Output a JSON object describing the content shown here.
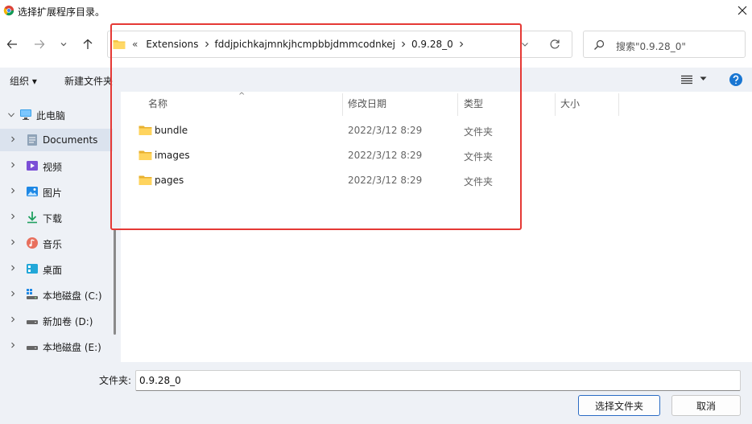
{
  "window": {
    "title": "选择扩展程序目录。"
  },
  "address": {
    "overflow": "«",
    "crumbs": [
      "Extensions",
      "fddjpichkajmnkjhcmpbbjdmmcodnkej",
      "0.9.28_0"
    ]
  },
  "search": {
    "placeholder": "搜索\"0.9.28_0\""
  },
  "commands": {
    "organize": "组织 ▾",
    "new_folder": "新建文件夹"
  },
  "sidebar": {
    "items": [
      {
        "label": "此电脑",
        "icon": "pc-icon"
      },
      {
        "label": "Documents",
        "icon": "documents-icon"
      },
      {
        "label": "视频",
        "icon": "video-icon"
      },
      {
        "label": "图片",
        "icon": "pictures-icon"
      },
      {
        "label": "下载",
        "icon": "download-icon"
      },
      {
        "label": "音乐",
        "icon": "music-icon"
      },
      {
        "label": "桌面",
        "icon": "desktop-icon"
      },
      {
        "label": "本地磁盘 (C:)",
        "icon": "drive-c-icon"
      },
      {
        "label": "新加卷 (D:)",
        "icon": "drive-icon"
      },
      {
        "label": "本地磁盘 (E:)",
        "icon": "drive-icon"
      }
    ]
  },
  "columns": {
    "name": "名称",
    "modified": "修改日期",
    "type": "类型",
    "size": "大小"
  },
  "files": [
    {
      "name": "bundle",
      "modified": "2022/3/12 8:29",
      "type": "文件夹"
    },
    {
      "name": "images",
      "modified": "2022/3/12 8:29",
      "type": "文件夹"
    },
    {
      "name": "pages",
      "modified": "2022/3/12 8:29",
      "type": "文件夹"
    }
  ],
  "footer": {
    "folder_label": "文件夹:",
    "folder_value": "0.9.28_0",
    "select_button": "选择文件夹",
    "cancel_button": "取消"
  },
  "colors": {
    "accent": "#2b6cc4",
    "highlight_box": "#e53935",
    "folder": "#f5c542",
    "panel_bg": "#eef1f6"
  }
}
